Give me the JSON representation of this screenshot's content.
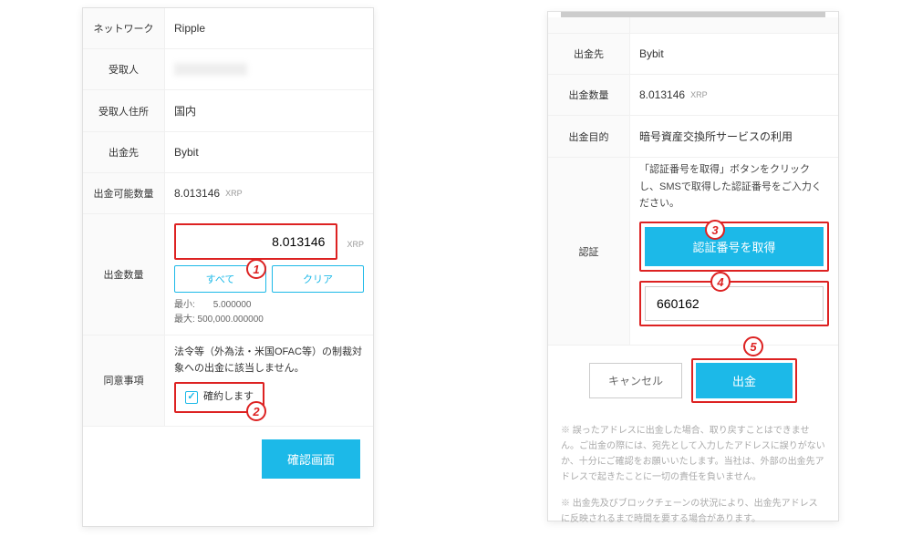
{
  "left": {
    "network": {
      "label": "ネットワーク",
      "value": "Ripple"
    },
    "recipient": {
      "label": "受取人"
    },
    "recipientAddr": {
      "label": "受取人住所",
      "value": "国内"
    },
    "withdrawTo": {
      "label": "出金先",
      "value": "Bybit"
    },
    "available": {
      "label": "出金可能数量",
      "value": "8.013146",
      "unit": "XRP"
    },
    "amount": {
      "label": "出金数量",
      "value": "8.013146",
      "unit": "XRP",
      "allBtn": "すべて",
      "clearBtn": "クリア",
      "min": "最小:　　5.000000",
      "max": "最大: 500,000.000000"
    },
    "consent": {
      "label": "同意事項",
      "text": "法令等（外為法・米国OFAC等）の制裁対象への出金に該当しません。",
      "check": "確約します"
    },
    "confirm": "確認画面"
  },
  "right": {
    "withdrawTo": {
      "label": "出金先",
      "value": "Bybit"
    },
    "amount": {
      "label": "出金数量",
      "value": "8.013146",
      "unit": "XRP"
    },
    "purpose": {
      "label": "出金目的",
      "value": "暗号資産交換所サービスの利用"
    },
    "auth": {
      "label": "認証",
      "desc": "「認証番号を取得」ボタンをクリックし、SMSで取得した認証番号をご入力ください。",
      "getBtn": "認証番号を取得",
      "code": "660162"
    },
    "cancel": "キャンセル",
    "submit": "出金",
    "note1": "※ 誤ったアドレスに出金した場合、取り戻すことはできません。ご出金の際には、宛先として入力したアドレスに誤りがないか、十分にご確認をお願いいたします。当社は、外部の出金先アドレスで起きたことに一切の責任を負いません。",
    "note2": "※ 出金先及びブロックチェーンの状況により、出金先アドレスに反映されるまで時間を要する場合があります。"
  }
}
